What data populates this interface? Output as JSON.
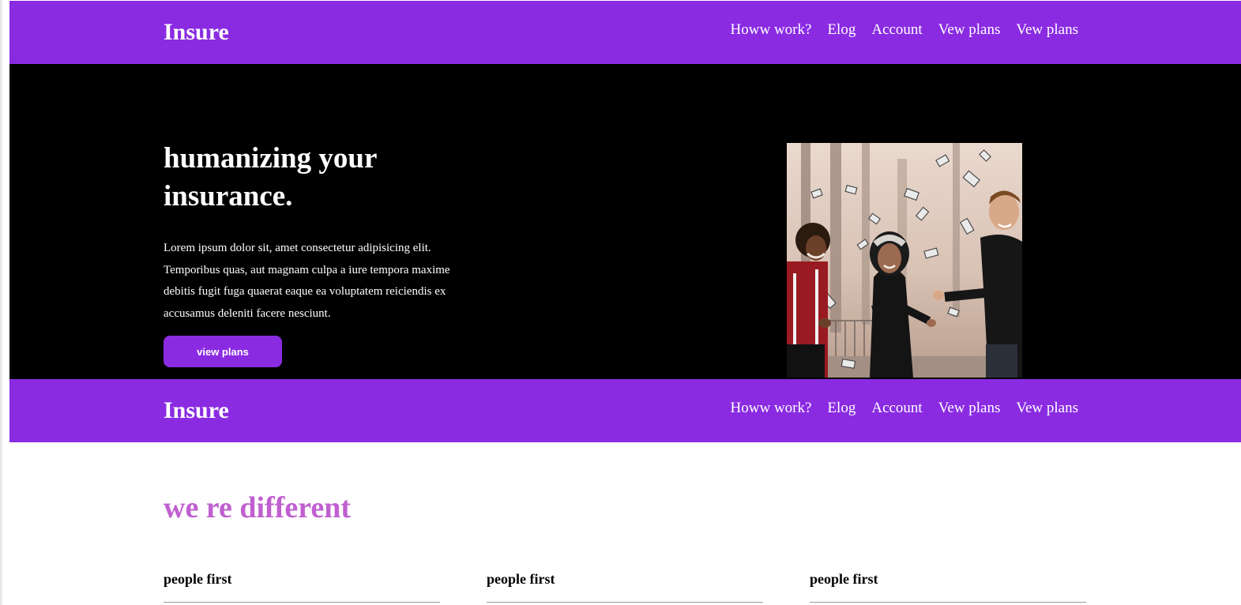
{
  "header": {
    "logo": "Insure",
    "nav": [
      "Howw work?",
      "Elog",
      "Account",
      "Vew plans",
      "Vew plans"
    ]
  },
  "hero": {
    "title": "humanizing your insurance.",
    "text": "Lorem ipsum dolor sit, amet consectetur adipisicing elit. Temporibus quas, aut magnam culpa a iure tempora maxime debitis fugit fuga quaerat eaque ea voluptatem reiciendis ex accusamus deleniti facere nesciunt.",
    "button_label": "view plans"
  },
  "second_header": {
    "logo": "Insure",
    "nav": [
      "Howw work?",
      "Elog",
      "Account",
      "Vew plans",
      "Vew plans"
    ]
  },
  "different": {
    "title": "we re different",
    "features": [
      {
        "title": "people first"
      },
      {
        "title": "people first"
      },
      {
        "title": "people first"
      }
    ]
  },
  "colors": {
    "brand_purple": "#8a2be2",
    "hero_background": "#000000",
    "accent_heading": "#c05fd0"
  }
}
